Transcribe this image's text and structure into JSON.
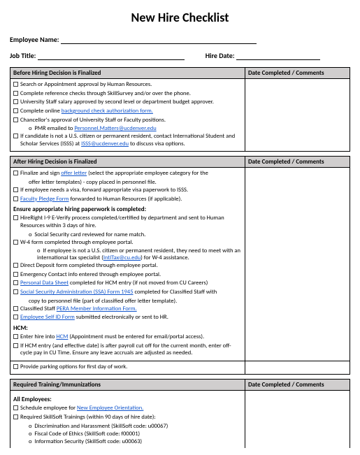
{
  "title": "New Hire Checklist",
  "fields": {
    "employee_name_label": "Employee Name:",
    "job_title_label": "Job Title:",
    "hire_date_label": "Hire Date:"
  },
  "col_comments": "Date Completed / Comments",
  "sections": {
    "before": {
      "header": "Before Hiring Decision  is Finalized",
      "items": {
        "i1": "Search or Appointment approval by Human Resources.",
        "i2": "Complete reference checks through SkillSurvey and/or over the phone.",
        "i3": "University Staff salary approved by second level or department budget approver.",
        "i4_pre": "Complete online ",
        "i4_link": "background check authorization form.",
        "i5": "Chancellor's approval of University Staff or Faculty positions.",
        "i5_sub_pre": "PMR emailed to ",
        "i5_sub_link": "Personnel.Matters@ucdenver.edu",
        "i6_pre": "If candidate is not a U.S. citizen or permanent resident, contact International Student and Scholar Services (ISSS) at ",
        "i6_link": "ISSS@ucdenver.edu",
        "i6_post": " to discuss visa options."
      }
    },
    "after": {
      "header": "After Hiring Decision  is Finalized",
      "items": {
        "i1_pre": "Finalize and sign ",
        "i1_link": "offer letter",
        "i1_post": " (select the appropriate employee category for the",
        "i1_post2": "offer letter templates) - copy placed in personnel file.",
        "i2": "If employee needs a visa, forward appropriate visa paperwork to ISSS.",
        "i3_link": "Faculty Pledge Form",
        "i3_post": " forwarded to Human Resources (if applicable).",
        "sub1": "Ensure appropriate hiring paperwork is completed:",
        "s1_i1": "HireRight I-9 E-Verify process completed/certified by department and sent to Human Resources within 3 days of hire.",
        "s1_i1_sub": "Social Security card reviewed for name match.",
        "s1_i2": "W-4 form completed through employee portal.",
        "s1_i2_sub_pre": "If employee is not a U.S. citizen or permanent resident, they need to meet with an international tax specialist (",
        "s1_i2_sub_link": "IntlTax@cu.edu",
        "s1_i2_sub_post": ") for W-4 assistance.",
        "s1_i3": "Direct Deposit form completed through employee portal.",
        "s1_i4": "Emergency Contact info entered through employee portal.",
        "s1_i5_link": "Personal Data Sheet",
        "s1_i5_post": " completed for HCM entry (if not moved from CU Careers)",
        "s1_i6_link": "Social Security Administration (SSA) Form 1945",
        "s1_i6_post": " completed for Classified Staff with",
        "s1_i6_post2": "copy to personnel file (part of classified offer letter template).",
        "s1_i7_pre": "Classified Staff ",
        "s1_i7_link": "PERA Member Information Form.",
        "s1_i8_link": "Employee Self ID Form",
        "s1_i8_post": " submitted electronically or sent to HR.",
        "sub2": "HCM:",
        "s2_i1_pre": "Enter hire into ",
        "s2_i1_link": "HCM",
        "s2_i1_post": " (Appointment must be entered for email/portal access).",
        "s2_i2": "If HCM entry (and effective date) is after payroll cut off for the current month, enter off-cycle pay in CU Time. Ensure any leave accruals are adjusted as needed.",
        "row2": "Provide parking options for first day of work."
      }
    },
    "training": {
      "header": "Required Training/Immunizations",
      "allemp": "All Employees:",
      "t1_pre": "Schedule employee for ",
      "t1_link": "New Employee Orientation.",
      "t2": "Required SkillSoft Trainings (within 90 days of hire date):",
      "t2_a": "Discrimination and Harassment (SkillSoft code: u00067)",
      "t2_b": "Fiscal Code of Ethics (SkillSoft code: f00001)",
      "t2_c": "Information Security (SkillSoft code: u00063)"
    }
  }
}
